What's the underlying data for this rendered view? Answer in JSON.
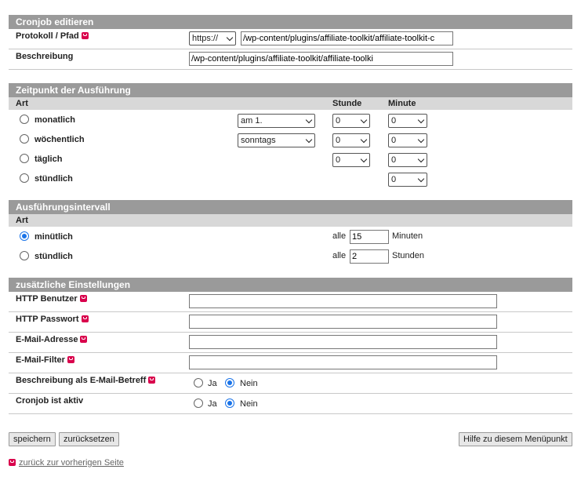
{
  "edit": {
    "title": "Cronjob editieren",
    "protocol_label": "Protokoll / Pfad",
    "protocol_value": "https://",
    "path_value": "/wp-content/plugins/affiliate-toolkit/affiliate-toolkit-c",
    "description_label": "Beschreibung",
    "description_value": "/wp-content/plugins/affiliate-toolkit/affiliate-toolki"
  },
  "schedule": {
    "title": "Zeitpunkt der Ausführung",
    "col_type": "Art",
    "col_hour": "Stunde",
    "col_minute": "Minute",
    "rows": [
      {
        "label": "monatlich",
        "day": "am 1.",
        "hour": "0",
        "minute": "0"
      },
      {
        "label": "wöchentlich",
        "day": "sonntags",
        "hour": "0",
        "minute": "0"
      },
      {
        "label": "täglich",
        "hour": "0",
        "minute": "0"
      },
      {
        "label": "stündlich",
        "minute": "0"
      }
    ]
  },
  "interval": {
    "title": "Ausführungsintervall",
    "col_type": "Art",
    "rows": [
      {
        "label": "minütlich",
        "prefix": "alle",
        "value": "15",
        "unit": "Minuten",
        "checked": true
      },
      {
        "label": "stündlich",
        "prefix": "alle",
        "value": "2",
        "unit": "Stunden",
        "checked": false
      }
    ]
  },
  "extra": {
    "title": "zusätzliche Einstellungen",
    "http_user_label": "HTTP Benutzer",
    "http_user_value": "",
    "http_pass_label": "HTTP Passwort",
    "http_pass_value": "",
    "email_label": "E-Mail-Adresse",
    "email_value": "",
    "email_filter_label": "E-Mail-Filter",
    "email_filter_value": "",
    "desc_subject_label": "Beschreibung als E-Mail-Betreff",
    "active_label": "Cronjob ist aktiv",
    "yes": "Ja",
    "no": "Nein"
  },
  "buttons": {
    "save": "speichern",
    "reset": "zurücksetzen",
    "help": "Hilfe zu diesem Menüpunkt"
  },
  "back_link": "zurück zur vorherigen Seite",
  "colors": {
    "header_bg": "#9a9a9a",
    "subheader_bg": "#d8d8d8",
    "help_icon": "#d9004c",
    "radio_active": "#1a73e8"
  }
}
